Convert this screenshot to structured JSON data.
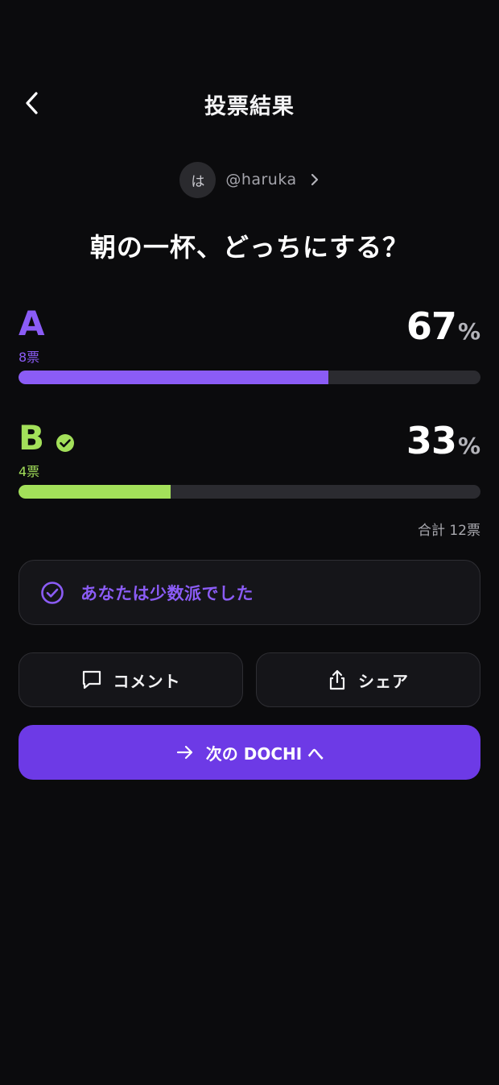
{
  "header": {
    "title": "投票結果",
    "back_icon": "chevron-left-icon"
  },
  "author": {
    "avatar_initial": "は",
    "handle": "@haruka",
    "chevron_icon": "chevron-right-icon"
  },
  "question": "朝の一杯、どっちにする？",
  "options": [
    {
      "letter": "A",
      "votes_label": "8票",
      "percent": "67",
      "percent_sign": "%",
      "share": 0.67,
      "color": "#8b5cf6",
      "selected": false
    },
    {
      "letter": "B",
      "votes_label": "4票",
      "percent": "33",
      "percent_sign": "%",
      "share": 0.33,
      "color": "#a3e05a",
      "selected": true,
      "selected_icon": "check-circle-icon"
    }
  ],
  "total_label": "合計 12票",
  "result": {
    "icon": "check-circle-outline-icon",
    "text": "あなたは少数派でした"
  },
  "actions": {
    "comment_label": "コメント",
    "comment_icon": "comment-icon",
    "share_label": "シェア",
    "share_icon": "share-icon",
    "next_label": "次の DOCHI へ",
    "next_icon": "arrow-right-icon"
  },
  "colors": {
    "background": "#0b0b0d",
    "accent": "#6d3ae6",
    "option_a": "#8b5cf6",
    "option_b": "#a3e05a"
  }
}
